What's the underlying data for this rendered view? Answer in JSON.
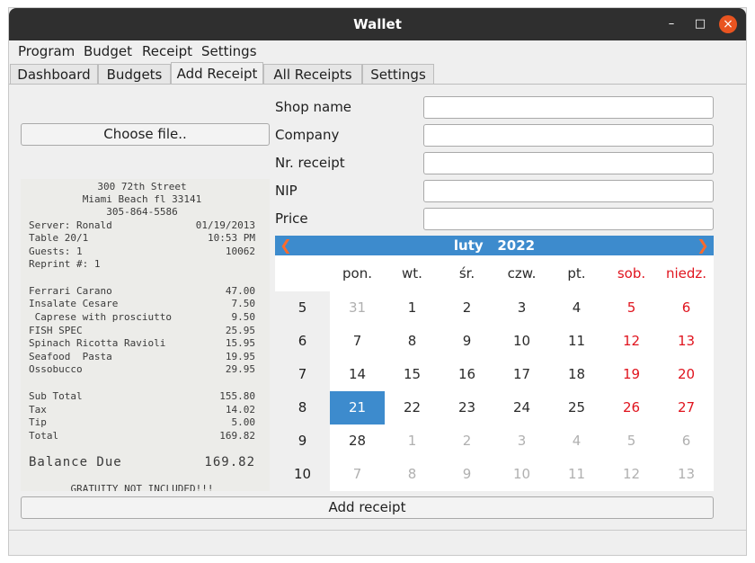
{
  "window": {
    "title": "Wallet",
    "minimize_glyph": "–",
    "maximize_glyph": "□",
    "close_glyph": "×"
  },
  "menu": [
    "Program",
    "Budget",
    "Receipt",
    "Settings"
  ],
  "tabs": [
    "Dashboard",
    "Budgets",
    "Add Receipt",
    "All Receipts",
    "Settings"
  ],
  "active_tab": "Add Receipt",
  "left": {
    "choose_file_label": "Choose file..",
    "receipt_lines": [
      {
        "l": "300 72th Street",
        "center": true
      },
      {
        "l": "Miami Beach fl 33141",
        "center": true
      },
      {
        "l": "305-864-5586",
        "center": true
      },
      {
        "l": "Server: Ronald",
        "r": "01/19/2013"
      },
      {
        "l": "Table 20/1",
        "r": "10:53 PM"
      },
      {
        "l": "Guests: 1",
        "r": "10062"
      },
      {
        "l": "Reprint #: 1"
      },
      {
        "l": "Ferrari Carano",
        "r": "47.00"
      },
      {
        "l": "Insalate Cesare",
        "r": "7.50"
      },
      {
        "l": " Caprese with prosciutto",
        "r": "9.50"
      },
      {
        "l": "FISH SPEC",
        "r": "25.95"
      },
      {
        "l": "Spinach Ricotta Ravioli",
        "r": "15.95"
      },
      {
        "l": "Seafood  Pasta",
        "r": "19.95"
      },
      {
        "l": "Ossobucco",
        "r": "29.95"
      },
      {
        "l": "Sub Total",
        "r": "155.80"
      },
      {
        "l": "Tax",
        "r": "14.02"
      },
      {
        "l": "Tip",
        "r": "5.00"
      },
      {
        "l": "Total",
        "r": "169.82"
      },
      {
        "l": "Balance Due",
        "r": "169.82",
        "big": true
      },
      {
        "l": "GRATUITY NOT INCLUDED!!!",
        "center": true
      }
    ]
  },
  "form": {
    "shop_name_label": "Shop name",
    "company_label": "Company",
    "receipt_nr_label": "Nr. receipt",
    "nip_label": "NIP",
    "price_label": "Price",
    "shop_name_value": "",
    "company_value": "",
    "receipt_nr_value": "",
    "nip_value": "",
    "price_value": ""
  },
  "calendar": {
    "month": "luty",
    "year": "2022",
    "prev_glyph": "❮",
    "next_glyph": "❯",
    "weekdays": [
      "pon.",
      "wt.",
      "śr.",
      "czw.",
      "pt.",
      "sob.",
      "niedz."
    ],
    "weeks": [
      {
        "wk": "5",
        "days": [
          "31",
          "1",
          "2",
          "3",
          "4",
          "5",
          "6"
        ]
      },
      {
        "wk": "6",
        "days": [
          "7",
          "8",
          "9",
          "10",
          "11",
          "12",
          "13"
        ]
      },
      {
        "wk": "7",
        "days": [
          "14",
          "15",
          "16",
          "17",
          "18",
          "19",
          "20"
        ]
      },
      {
        "wk": "8",
        "days": [
          "21",
          "22",
          "23",
          "24",
          "25",
          "26",
          "27"
        ]
      },
      {
        "wk": "9",
        "days": [
          "28",
          "1",
          "2",
          "3",
          "4",
          "5",
          "6"
        ]
      },
      {
        "wk": "10",
        "days": [
          "7",
          "8",
          "9",
          "10",
          "11",
          "12",
          "13"
        ]
      }
    ],
    "selected_day": "21",
    "weekend_color": "#e0141e",
    "selection_color": "#3d8bcd"
  },
  "add_receipt_label": "Add receipt"
}
